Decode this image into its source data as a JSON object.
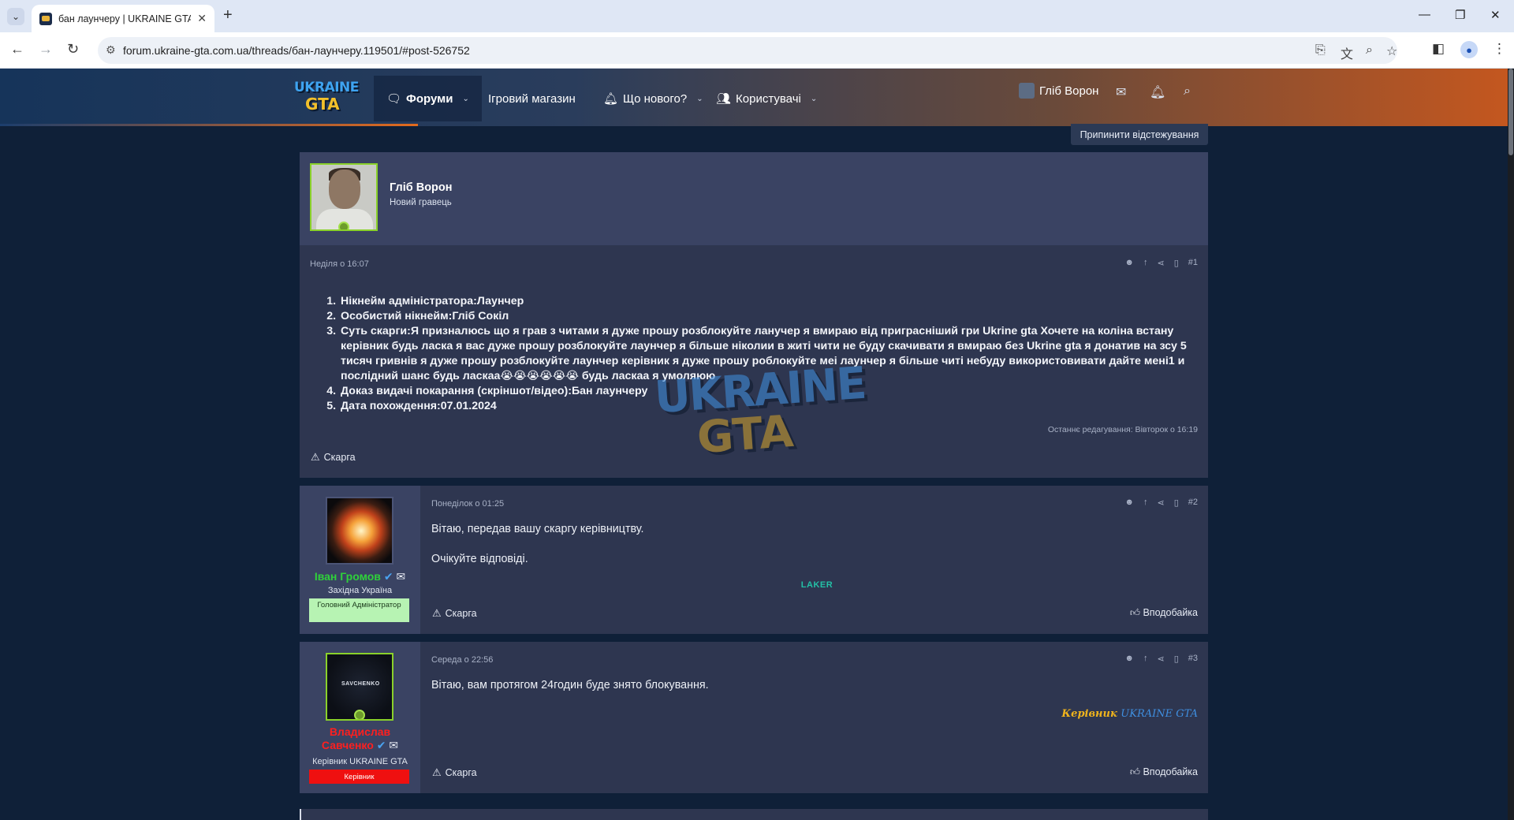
{
  "browser": {
    "tab_title": "бан лаунчеру | UKRAINE GTA - ",
    "new_tab": "+",
    "url": "forum.ukraine-gta.com.ua/threads/бан-лаунчеру.119501/#post-526752",
    "win_min": "—",
    "win_restore": "❐",
    "win_close": "✕"
  },
  "header": {
    "logo_top": "UKRAINE",
    "logo_bottom": "GTA",
    "nav": {
      "forums": "Форуми",
      "shop": "Ігровий магазин",
      "whats_new": "Що нового?",
      "users": "Користувачі"
    },
    "user_name": "Гліб Ворон"
  },
  "thread": {
    "unwatch_label": "Припинити відстежування"
  },
  "op": {
    "author": "Гліб Ворон",
    "rank": "Новий гравець",
    "date": "Неділя о 16:07",
    "number": "#1",
    "items": [
      "Нікнейм адміністратора:Лаунчер",
      "Особистий нікнейм:Гліб Сокіл",
      "Суть скарги:Я призналюсь що я грав з читами я дуже прошу розблокуйте ланучер я вмираю від пригрaсніший гри Ukrine gta Хочете на коліна встану керівник будь ласка я вас дуже прошу розблокуйте лаунчер я більше ніколии в житі чити не буду скачивати я вмираю без Ukrine gta я донатив на зсу 5 тисяч гривнів я дуже прошу розблокуйте лаунчер керівник я дуже прошу роблокуйте меі лаунчер я більше читі небуду використовивати дайте мені1 и послідний шанс будь ласкаа😭😭😭😭😭😭 будь ласкаа я умоляюю",
      "Доказ видачі покарання (скріншот/відео):Бан лаунчеру",
      "Дата похождення:07.01.2024"
    ],
    "edited": "Останнє редагування: Вівторок о 16:19",
    "report": "Скарга"
  },
  "reply1": {
    "author": "Іван Громов",
    "user_title": "Західна Україна",
    "badge": "Головний Адміністратор",
    "date": "Понеділок о 01:25",
    "number": "#2",
    "line1": "Вітаю, передав вашу скаргу керівництву.",
    "line2": "Очікуйте відповіді.",
    "signature": "LAKER",
    "report": "Скарга",
    "like": "Вподобайка"
  },
  "reply2": {
    "author_line1": "Владислав",
    "author_line2": "Савченко",
    "user_title": "Керівник UKRAINE GTA",
    "badge": "Керівник",
    "avatar_text": "SAVCHENKO",
    "date": "Середа о 22:56",
    "number": "#3",
    "line1": "Вітаю, вам протягом 24годин буде знято блокування.",
    "sig_part1": "Керівник",
    "sig_part2": "UKRAINE GTA",
    "report": "Скарга",
    "like": "Вподобайка"
  },
  "colors": {
    "admin_green": "#2fd13a",
    "lead_red": "#ff1f1f",
    "sig_gold": "#f0b41c",
    "sig_blue": "#3f8fe0",
    "post_bg": "#2e3650"
  }
}
